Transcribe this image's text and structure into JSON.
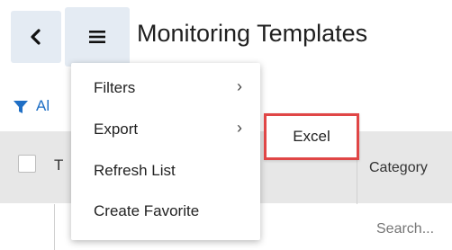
{
  "header": {
    "back_icon": "chevron-left-icon",
    "menu_icon": "hamburger-icon",
    "title": "Monitoring Templates"
  },
  "filter_bar": {
    "filter_icon": "funnel-icon",
    "all_label": "Al",
    "accent_color": "#1f6fc5"
  },
  "table": {
    "first_col_label": "T",
    "category_label": "Category",
    "search_placeholder": "Search..."
  },
  "menu": {
    "items": [
      {
        "label": "Filters",
        "has_submenu": true
      },
      {
        "label": "Export",
        "has_submenu": true
      },
      {
        "label": "Refresh List",
        "has_submenu": false
      },
      {
        "label": "Create Favorite",
        "has_submenu": false
      }
    ]
  },
  "submenu": {
    "items": [
      {
        "label": "Excel"
      }
    ],
    "highlight_color": "#e04646"
  }
}
